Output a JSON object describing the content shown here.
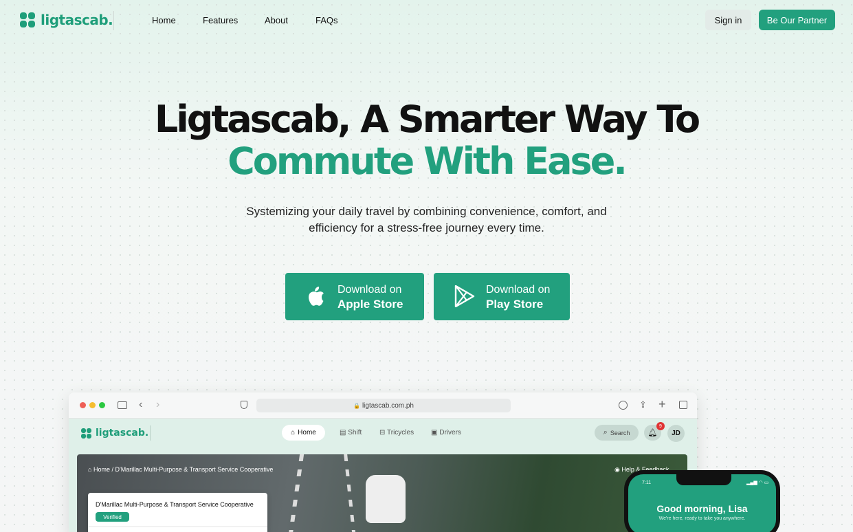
{
  "brand": {
    "name": "ligtascab."
  },
  "nav": {
    "items": [
      "Home",
      "Features",
      "About",
      "FAQs"
    ],
    "sign_in": "Sign in",
    "partner": "Be Our Partner"
  },
  "hero": {
    "line1": "Ligtascab, A Smarter Way To",
    "line2": "Commute With Ease.",
    "subtitle1": "Systemizing your daily travel by combining convenience, comfort, and",
    "subtitle2": "efficiency for a stress-free journey every time."
  },
  "stores": {
    "apple": {
      "top": "Download on",
      "bottom": "Apple Store"
    },
    "play": {
      "top": "Download on",
      "bottom": "Play Store"
    }
  },
  "browser": {
    "url": "ligtascab.com.ph",
    "app": {
      "brand": "ligtascab.",
      "tabs": [
        "Home",
        "Shift",
        "Tricycles",
        "Drivers"
      ],
      "search": "Search",
      "notif_count": "9",
      "avatar": "JD",
      "breadcrumb_home": "Home",
      "breadcrumb_sep": "/",
      "breadcrumb_page": "D'Marillac Multi-Purpose & Transport Service Cooperative",
      "help": "Help & Feedback",
      "card_title": "D'Marillac Multi-Purpose & Transport Service Cooperative",
      "card_badge": "Verified"
    }
  },
  "phone": {
    "time": "7:11",
    "greeting": "Good morning, Lisa",
    "tagline": "We're here, ready to take you anywhere."
  },
  "colors": {
    "accent": "#22a07e",
    "dark": "#111111"
  }
}
